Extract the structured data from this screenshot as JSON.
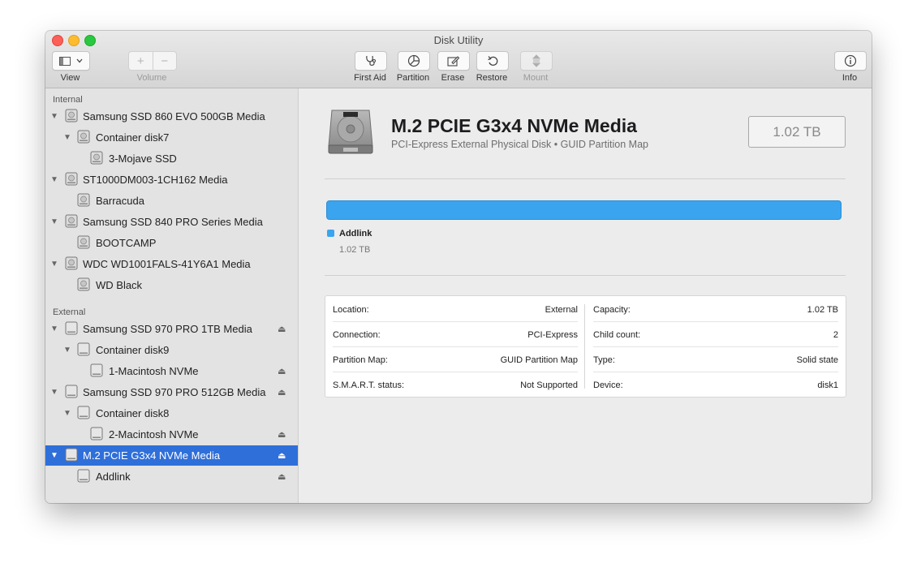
{
  "window": {
    "title": "Disk Utility"
  },
  "toolbar": {
    "view": "View",
    "volume": "Volume",
    "first_aid": "First Aid",
    "partition": "Partition",
    "erase": "Erase",
    "restore": "Restore",
    "mount": "Mount",
    "info": "Info"
  },
  "sidebar": {
    "internal_header": "Internal",
    "external_header": "External",
    "items": [
      {
        "label": "Samsung SSD 860 EVO 500GB Media"
      },
      {
        "label": "Container disk7"
      },
      {
        "label": "3-Mojave SSD"
      },
      {
        "label": "ST1000DM003-1CH162 Media"
      },
      {
        "label": "Barracuda"
      },
      {
        "label": "Samsung SSD 840 PRO Series Media"
      },
      {
        "label": "BOOTCAMP"
      },
      {
        "label": "WDC WD1001FALS-41Y6A1 Media"
      },
      {
        "label": "WD Black"
      },
      {
        "label": "Samsung SSD 970 PRO 1TB Media"
      },
      {
        "label": "Container disk9"
      },
      {
        "label": "1-Macintosh NVMe"
      },
      {
        "label": "Samsung SSD 970 PRO 512GB Media"
      },
      {
        "label": "Container disk8"
      },
      {
        "label": "2-Macintosh NVMe"
      },
      {
        "label": "M.2 PCIE G3x4 NVMe Media"
      },
      {
        "label": "Addlink"
      }
    ]
  },
  "drive": {
    "title": "M.2 PCIE G3x4 NVMe Media",
    "subtitle": "PCI-Express External Physical Disk • GUID Partition Map",
    "size": "1.02 TB"
  },
  "usage": {
    "fraction": 1.0,
    "color": "#3aa4ef",
    "legend_name": "Addlink",
    "legend_size": "1.02 TB"
  },
  "info": {
    "left": [
      {
        "label": "Location:",
        "value": "External"
      },
      {
        "label": "Connection:",
        "value": "PCI-Express"
      },
      {
        "label": "Partition Map:",
        "value": "GUID Partition Map"
      },
      {
        "label": "S.M.A.R.T. status:",
        "value": "Not Supported"
      }
    ],
    "right": [
      {
        "label": "Capacity:",
        "value": "1.02 TB"
      },
      {
        "label": "Child count:",
        "value": "2"
      },
      {
        "label": "Type:",
        "value": "Solid state"
      },
      {
        "label": "Device:",
        "value": "disk1"
      }
    ]
  },
  "eject_glyph": "⏏",
  "disclosure_glyph": "▼"
}
